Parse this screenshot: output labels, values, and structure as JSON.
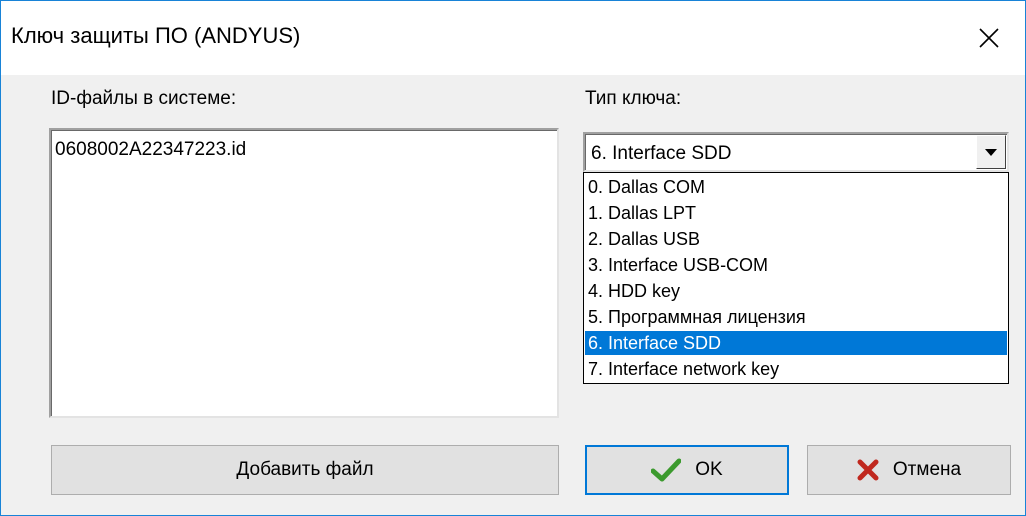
{
  "window": {
    "title": "Ключ защиты ПО (ANDYUS)",
    "close_icon": "close-icon"
  },
  "id_files": {
    "label": "ID-файлы в системе:",
    "items": [
      "0608002A22347223.id"
    ]
  },
  "key_type": {
    "label": "Тип ключа:",
    "selected": "6. Interface SDD",
    "options": [
      "0. Dallas COM",
      "1. Dallas LPT",
      "2. Dallas USB",
      "3. Interface USB-COM",
      "4. HDD key",
      "5. Программная лицензия",
      "6. Interface SDD",
      "7. Interface network key"
    ],
    "selected_index": 6
  },
  "buttons": {
    "add_file": "Добавить файл",
    "ok": "OK",
    "cancel": "Отмена",
    "ok_icon": "checkmark-icon",
    "cancel_icon": "cross-icon"
  },
  "colors": {
    "selection": "#0078d7",
    "ok_check": "#3c9a2e",
    "cancel_cross": "#c0281e"
  }
}
